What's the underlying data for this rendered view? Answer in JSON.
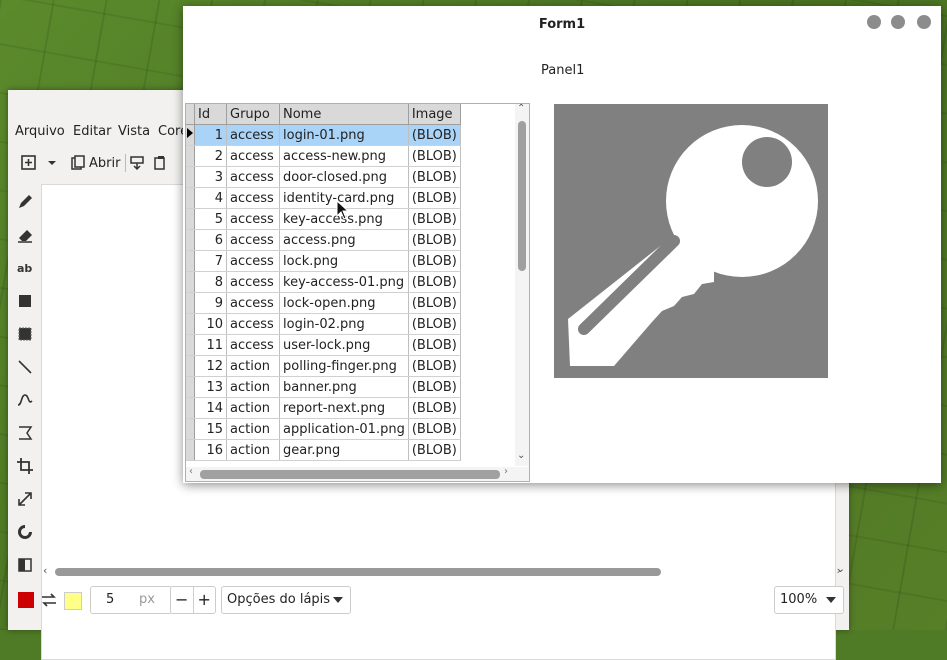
{
  "paint": {
    "menu": [
      "Arquivo",
      "Editar",
      "Vista",
      "Core"
    ],
    "toolbar": {
      "open_label": "Abrir"
    },
    "status": {
      "primary_color": "#cc0000",
      "secondary_color": "#ffff88",
      "brush_size": "5",
      "brush_unit": "px",
      "minus": "−",
      "plus": "+",
      "options_label": "Opções do lápis",
      "zoom": "100%"
    }
  },
  "form": {
    "title": "Form1",
    "panel_label": "Panel1",
    "columns": [
      "Id",
      "Grupo",
      "Nome",
      "Image"
    ],
    "rows": [
      {
        "id": "1",
        "grupo": "access",
        "nome": "login-01.png",
        "image": "(BLOB)"
      },
      {
        "id": "2",
        "grupo": "access",
        "nome": "access-new.png",
        "image": "(BLOB)"
      },
      {
        "id": "3",
        "grupo": "access",
        "nome": "door-closed.png",
        "image": "(BLOB)"
      },
      {
        "id": "4",
        "grupo": "access",
        "nome": "identity-card.png",
        "image": "(BLOB)"
      },
      {
        "id": "5",
        "grupo": "access",
        "nome": "key-access.png",
        "image": "(BLOB)"
      },
      {
        "id": "6",
        "grupo": "access",
        "nome": "access.png",
        "image": "(BLOB)"
      },
      {
        "id": "7",
        "grupo": "access",
        "nome": "lock.png",
        "image": "(BLOB)"
      },
      {
        "id": "8",
        "grupo": "access",
        "nome": "key-access-01.png",
        "image": "(BLOB)"
      },
      {
        "id": "9",
        "grupo": "access",
        "nome": "lock-open.png",
        "image": "(BLOB)"
      },
      {
        "id": "10",
        "grupo": "access",
        "nome": "login-02.png",
        "image": "(BLOB)"
      },
      {
        "id": "11",
        "grupo": "access",
        "nome": "user-lock.png",
        "image": "(BLOB)"
      },
      {
        "id": "12",
        "grupo": "action",
        "nome": "polling-finger.png",
        "image": "(BLOB)"
      },
      {
        "id": "13",
        "grupo": "action",
        "nome": "banner.png",
        "image": "(BLOB)"
      },
      {
        "id": "14",
        "grupo": "action",
        "nome": "report-next.png",
        "image": "(BLOB)"
      },
      {
        "id": "15",
        "grupo": "action",
        "nome": "application-01.png",
        "image": "(BLOB)"
      },
      {
        "id": "16",
        "grupo": "action",
        "nome": "gear.png",
        "image": "(BLOB)"
      }
    ],
    "selected_row": 1,
    "image_icon": "key-icon"
  }
}
